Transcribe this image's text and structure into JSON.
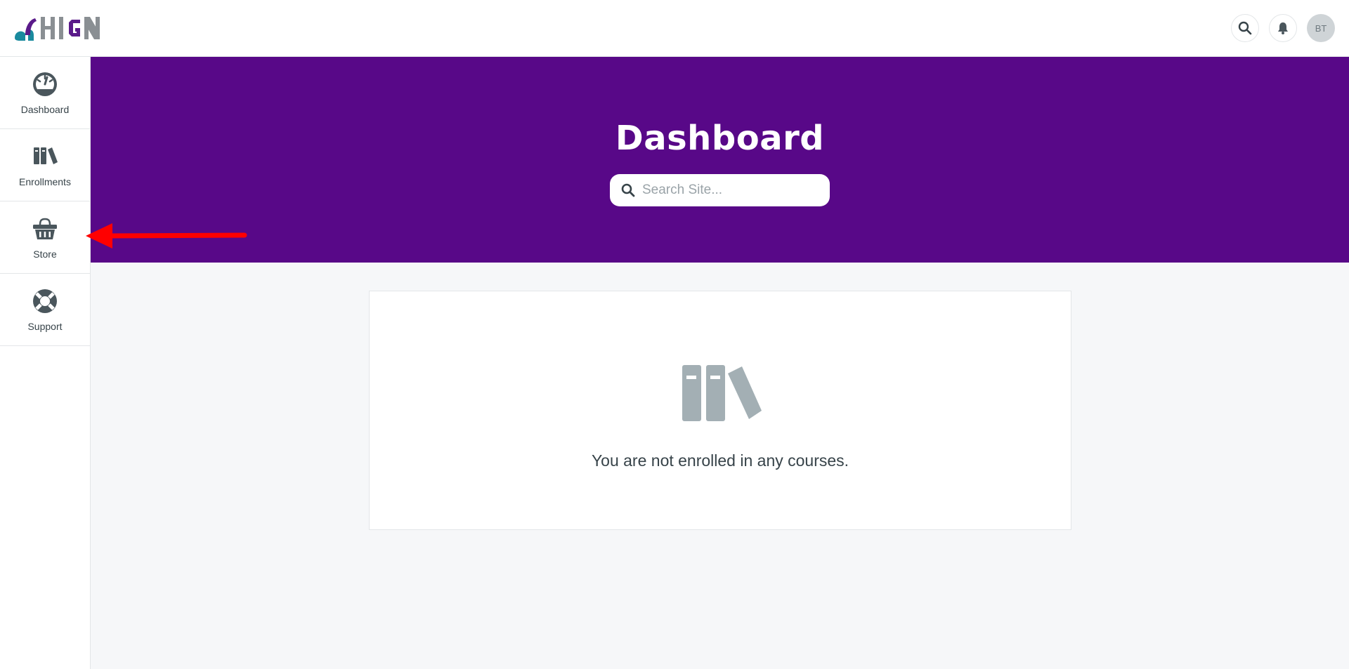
{
  "brand": {
    "logo_text": "HIGN",
    "logo_colors": [
      "#1a8a9e",
      "#5a1a8a",
      "#8a8f93"
    ]
  },
  "topbar": {
    "search_icon": "search-icon",
    "notifications_icon": "bell-icon",
    "avatar_initials": "BT"
  },
  "sidebar": {
    "items": [
      {
        "label": "Dashboard",
        "icon": "speedometer-icon"
      },
      {
        "label": "Enrollments",
        "icon": "books-icon"
      },
      {
        "label": "Store",
        "icon": "basket-icon"
      },
      {
        "label": "Support",
        "icon": "lifebuoy-icon"
      }
    ]
  },
  "hero": {
    "title": "Dashboard",
    "search_placeholder": "Search Site...",
    "background": "#580888"
  },
  "main": {
    "empty_icon": "books-icon",
    "empty_message": "You are not enrolled in any courses."
  },
  "annotation": {
    "arrow_color": "#ff0000",
    "arrow_icon": "arrow-left-icon"
  }
}
